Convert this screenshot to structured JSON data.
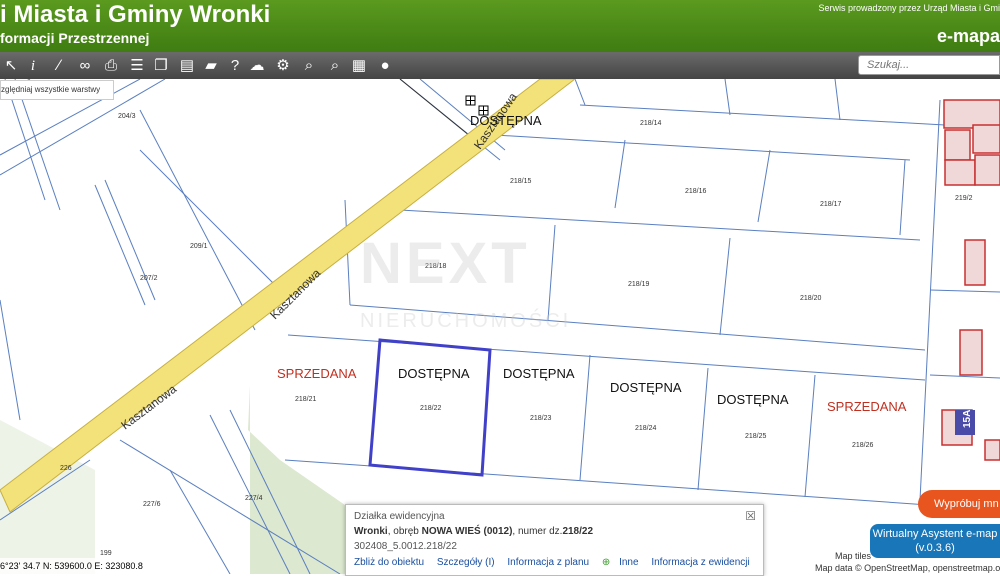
{
  "header": {
    "title": "i Miasta i Gminy Wronki",
    "subtitle": "formacji Przestrzennej",
    "service_note": "Serwis prowadzony przez Urząd Miasta i Gmi",
    "brand": "e-mapa"
  },
  "toolbar": {
    "search_placeholder": "Szukaj...",
    "layers_note": "zględniaj wszystkie warstwy"
  },
  "map": {
    "streets": [
      "Kasztanowa",
      "Kasztanowa",
      "Kasztanowa"
    ],
    "parcel_numbers": [
      "204/3",
      "218/14",
      "218/15",
      "218/16",
      "218/17",
      "209/1",
      "207/2",
      "218/18",
      "218/19",
      "218/20",
      "218/21",
      "218/22",
      "218/23",
      "218/24",
      "218/25",
      "218/26",
      "219/2",
      "227/6",
      "227/4",
      "226",
      "199"
    ],
    "labels": [
      {
        "text": "DOSTĘPNA",
        "status": "available"
      },
      {
        "text": "SPRZEDANA",
        "status": "sold"
      },
      {
        "text": "DOSTĘPNA",
        "status": "available"
      },
      {
        "text": "DOSTĘPNA",
        "status": "available"
      },
      {
        "text": "DOSTĘPNA",
        "status": "available"
      },
      {
        "text": "DOSTĘPNA",
        "status": "available"
      },
      {
        "text": "SPRZEDANA",
        "status": "sold"
      }
    ],
    "building_number": "15A",
    "watermark": "NEXT",
    "watermark_sub": "NIERUCHOMOŚCI"
  },
  "info_panel": {
    "heading": "Działka ewidencyjna",
    "town": "Wronki",
    "precinct_text": ", obręb ",
    "precinct": "NOWA WIEŚ (0012)",
    "number_text": ", numer dz.",
    "number": "218/22",
    "code": "302408_5.0012.218/22",
    "links": [
      "Zbliż do obiektu",
      "Szczegóły (I)",
      "Informacja z planu",
      "Inne",
      "Informacja z ewidencji"
    ]
  },
  "overlays": {
    "try_button": "Wypróbuj mn",
    "assistant": "Wirtualny Asystent e-map",
    "assistant_version": "(v.0.3.6)",
    "map_tiles": "Map tiles",
    "map_data": "Map data © OpenStreetMap, openstreetmap.o",
    "coords": "6°23' 34.7   N: 539600.0   E: 323080.8"
  },
  "colors": {
    "header_green": "#4a8a18",
    "road_yellow": "#f3e27a",
    "parcel_line": "#5a7fc0",
    "selected_parcel": "#4040c8",
    "sold_red": "#c03020",
    "building_red": "#c83030",
    "green_area": "#dce8cf"
  }
}
